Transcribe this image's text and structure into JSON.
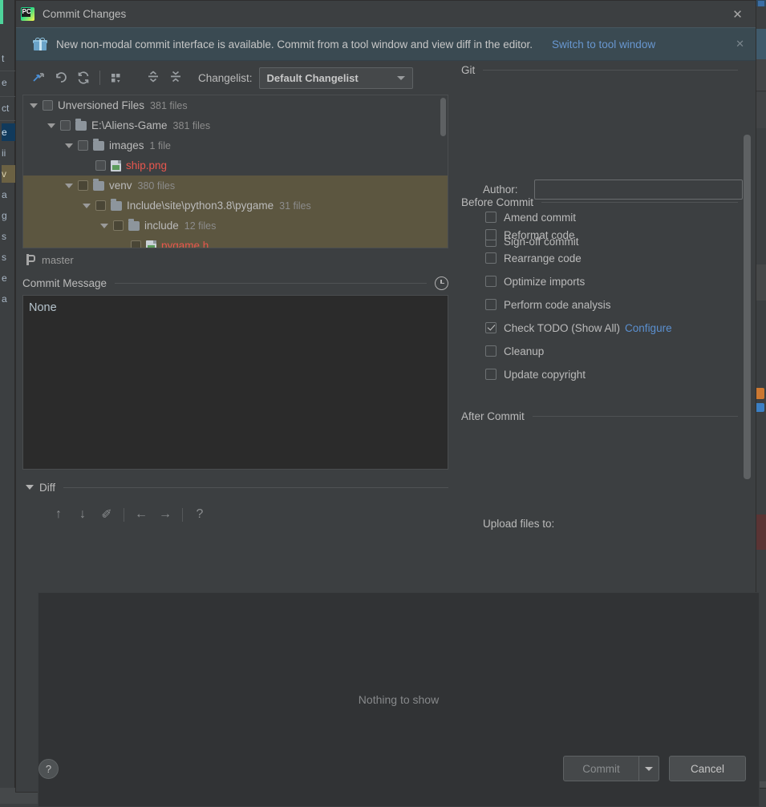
{
  "window": {
    "title": "Commit Changes",
    "logo_text": "PC",
    "close_label": "✕"
  },
  "banner": {
    "message": "New non-modal commit interface is available. Commit from a tool window and view diff in the editor.",
    "link": "Switch to tool window",
    "close_label": "✕"
  },
  "toolbar": {
    "changelist_label": "Changelist:",
    "changelist_value": "Default Changelist"
  },
  "tree": {
    "rows": [
      {
        "indent": 0,
        "twisty": true,
        "checkbox": true,
        "folder": false,
        "file": false,
        "name": "Unversioned Files",
        "count": "381 files",
        "selected": false,
        "red": false
      },
      {
        "indent": 1,
        "twisty": true,
        "checkbox": true,
        "folder": true,
        "file": false,
        "name": "E:\\Aliens-Game",
        "count": "381 files",
        "selected": false,
        "red": false
      },
      {
        "indent": 2,
        "twisty": true,
        "checkbox": true,
        "folder": true,
        "file": false,
        "name": "images",
        "count": "1 file",
        "selected": false,
        "red": false
      },
      {
        "indent": 3,
        "twisty": false,
        "checkbox": true,
        "folder": false,
        "file": true,
        "name": "ship.png",
        "count": "",
        "selected": false,
        "red": true
      },
      {
        "indent": 2,
        "twisty": true,
        "checkbox": true,
        "folder": true,
        "file": false,
        "name": "venv",
        "count": "380 files",
        "selected": true,
        "red": false
      },
      {
        "indent": 3,
        "twisty": true,
        "checkbox": true,
        "folder": true,
        "file": false,
        "name": "Include\\site\\python3.8\\pygame",
        "count": "31 files",
        "selected": true,
        "red": false
      },
      {
        "indent": 4,
        "twisty": true,
        "checkbox": true,
        "folder": true,
        "file": false,
        "name": "include",
        "count": "12 files",
        "selected": true,
        "red": false
      },
      {
        "indent": 5,
        "twisty": false,
        "checkbox": true,
        "folder": false,
        "file": true,
        "name": "pygame.h",
        "count": "",
        "selected": true,
        "red": true
      }
    ]
  },
  "branch": {
    "name": "master"
  },
  "commit_message": {
    "title": "Commit Message",
    "value": "None",
    "history_icon": "clock-icon"
  },
  "diff": {
    "title": "Diff",
    "empty_text": "Nothing to show",
    "toolbar": [
      {
        "icon": "arrow-up-icon",
        "glyph": "↑"
      },
      {
        "icon": "arrow-down-icon",
        "glyph": "↓"
      },
      {
        "icon": "edit-pencil-icon",
        "glyph": "✐"
      },
      {
        "icon": "arrow-left-icon",
        "glyph": "←"
      },
      {
        "icon": "arrow-right-icon",
        "glyph": "→"
      },
      {
        "icon": "help-question-icon",
        "glyph": "?"
      }
    ]
  },
  "git_section": {
    "title": "Git",
    "author_label": "Author:",
    "author_value": "",
    "checkboxes": [
      {
        "label": "Amend commit",
        "checked": false
      },
      {
        "label": "Sign-off commit",
        "checked": false
      }
    ]
  },
  "before_commit": {
    "title": "Before Commit",
    "checkboxes": [
      {
        "label": "Reformat code",
        "checked": false,
        "link": ""
      },
      {
        "label": "Rearrange code",
        "checked": false,
        "link": ""
      },
      {
        "label": "Optimize imports",
        "checked": false,
        "link": ""
      },
      {
        "label": "Perform code analysis",
        "checked": false,
        "link": ""
      },
      {
        "label": "Check TODO (Show All)",
        "checked": true,
        "link": "Configure"
      },
      {
        "label": "Cleanup",
        "checked": false,
        "link": ""
      },
      {
        "label": "Update copyright",
        "checked": false,
        "link": ""
      }
    ]
  },
  "after_commit": {
    "title": "After Commit",
    "upload_label": "Upload files to:"
  },
  "footer": {
    "help_label": "?",
    "commit_label": "Commit",
    "cancel_label": "Cancel"
  },
  "colors": {
    "background": "#3c3f41",
    "banner_bg": "#3a4a52",
    "link": "#6897d0",
    "selection": "#5c5640",
    "file_red": "#e8574e",
    "text": "#bbbbbb",
    "editor_bg": "#2b2b2b"
  }
}
